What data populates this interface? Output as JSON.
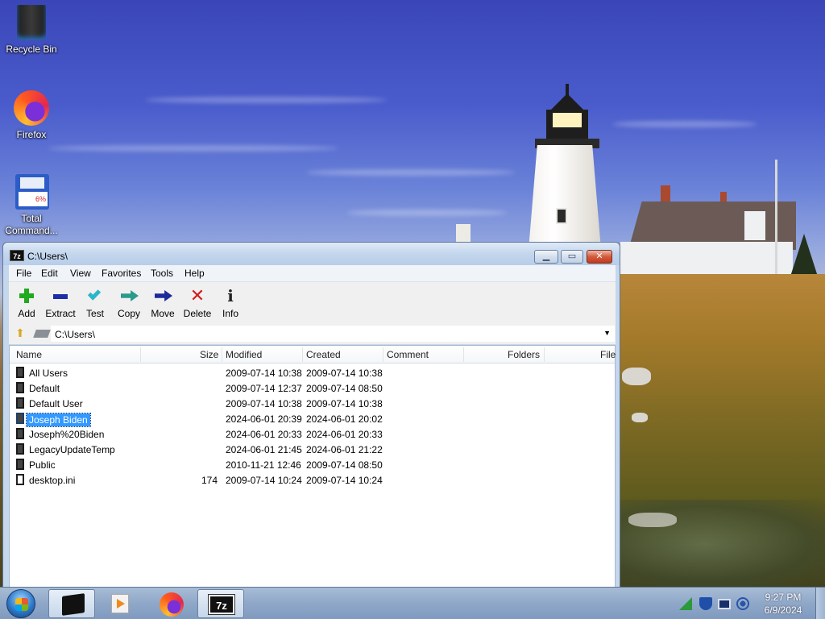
{
  "desktop": {
    "icons": [
      {
        "label": "Recycle Bin",
        "icon": "recycle-bin-icon"
      },
      {
        "label": "Firefox",
        "icon": "firefox-icon"
      },
      {
        "label": "Total Command...",
        "icon": "total-commander-icon"
      }
    ]
  },
  "window": {
    "app_icon_text": "7z",
    "title": "C:\\Users\\",
    "menu": [
      "File",
      "Edit",
      "View",
      "Favorites",
      "Tools",
      "Help"
    ],
    "toolbar": [
      {
        "label": "Add",
        "icon": "add-plus-icon"
      },
      {
        "label": "Extract",
        "icon": "extract-minus-icon"
      },
      {
        "label": "Test",
        "icon": "test-check-icon"
      },
      {
        "label": "Copy",
        "icon": "copy-arrow-icon"
      },
      {
        "label": "Move",
        "icon": "move-arrow-icon"
      },
      {
        "label": "Delete",
        "icon": "delete-x-icon"
      },
      {
        "label": "Info",
        "icon": "info-icon"
      }
    ],
    "address": "C:\\Users\\",
    "columns": [
      "Name",
      "Size",
      "Modified",
      "Created",
      "Comment",
      "Folders",
      "File"
    ],
    "rows": [
      {
        "name": "All Users",
        "size": "",
        "modified": "2009-07-14 10:38",
        "created": "2009-07-14 10:38",
        "type": "folder",
        "selected": false
      },
      {
        "name": "Default",
        "size": "",
        "modified": "2009-07-14 12:37",
        "created": "2009-07-14 08:50",
        "type": "folder",
        "selected": false
      },
      {
        "name": "Default User",
        "size": "",
        "modified": "2009-07-14 10:38",
        "created": "2009-07-14 10:38",
        "type": "folder",
        "selected": false
      },
      {
        "name": "Joseph Biden",
        "size": "",
        "modified": "2024-06-01 20:39",
        "created": "2024-06-01 20:02",
        "type": "folder",
        "selected": true
      },
      {
        "name": "Joseph%20Biden",
        "size": "",
        "modified": "2024-06-01 20:33",
        "created": "2024-06-01 20:33",
        "type": "folder",
        "selected": false
      },
      {
        "name": "LegacyUpdateTemp",
        "size": "",
        "modified": "2024-06-01 21:45",
        "created": "2024-06-01 21:22",
        "type": "folder",
        "selected": false
      },
      {
        "name": "Public",
        "size": "",
        "modified": "2010-11-21 12:46",
        "created": "2009-07-14 08:50",
        "type": "folder",
        "selected": false
      },
      {
        "name": "desktop.ini",
        "size": "174",
        "modified": "2009-07-14 10:24",
        "created": "2009-07-14 10:24",
        "type": "file",
        "selected": false
      }
    ]
  },
  "taskbar": {
    "apps": [
      {
        "icon": "command-prompt-icon",
        "active": true
      },
      {
        "icon": "media-player-icon",
        "active": false
      },
      {
        "icon": "firefox-icon",
        "active": false
      },
      {
        "icon": "7zip-icon",
        "label": "7z",
        "active": true
      }
    ],
    "clock": {
      "time": "9:27 PM",
      "date": "6/9/2024"
    }
  }
}
